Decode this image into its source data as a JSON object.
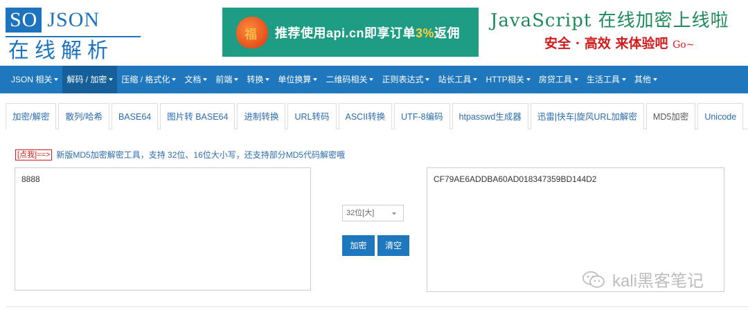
{
  "logo": {
    "so": "SO",
    "json": "JSON",
    "cn": "在线解析"
  },
  "banner": {
    "text_prefix": "推荐使用api.cn即享订单",
    "text_highlight": "3%",
    "text_suffix": "返佣",
    "bag_icon": "red-envelope-icon"
  },
  "promo": {
    "line1": "JavaScript 在线加密上线啦",
    "line2": "安全 · 高效  来体验吧",
    "go": "Go~"
  },
  "nav": {
    "items": [
      {
        "label": "JSON 相关"
      },
      {
        "label": "解码 / 加密"
      },
      {
        "label": "压缩 / 格式化"
      },
      {
        "label": "文档"
      },
      {
        "label": "前端"
      },
      {
        "label": "转换"
      },
      {
        "label": "单位换算"
      },
      {
        "label": "二维码相关"
      },
      {
        "label": "正则表达式"
      },
      {
        "label": "站长工具"
      },
      {
        "label": "HTTP相关"
      },
      {
        "label": "房贷工具"
      },
      {
        "label": "生活工具"
      },
      {
        "label": "其他"
      }
    ],
    "active_index": 1,
    "bg_color": "#1f77bd"
  },
  "tabs": {
    "items": [
      {
        "label": "加密/解密"
      },
      {
        "label": "散列/哈希"
      },
      {
        "label": "BASE64"
      },
      {
        "label": "图片转 BASE64"
      },
      {
        "label": "进制转换"
      },
      {
        "label": "URL转码"
      },
      {
        "label": "ASCII转换"
      },
      {
        "label": "UTF-8编码"
      },
      {
        "label": "htpasswd生成器"
      },
      {
        "label": "迅雷|快车|旋风URL加解密"
      },
      {
        "label": "MD5加密"
      },
      {
        "label": "Unicode"
      }
    ],
    "active_index": 10
  },
  "info": {
    "tag": "[点我]==>",
    "text": "新版MD5加密解密工具，支持 32位、16位大小写，还支持部分MD5代码解密哦"
  },
  "input": {
    "value": "8888"
  },
  "output": {
    "value": "CF79AE6ADDBA60AD018347359BD144D2"
  },
  "select": {
    "selected": "32位[大]"
  },
  "buttons": {
    "encrypt": "加密",
    "clear": "清空"
  },
  "watermark": {
    "text": "kali黑客笔记",
    "icon": "wechat-icon"
  }
}
